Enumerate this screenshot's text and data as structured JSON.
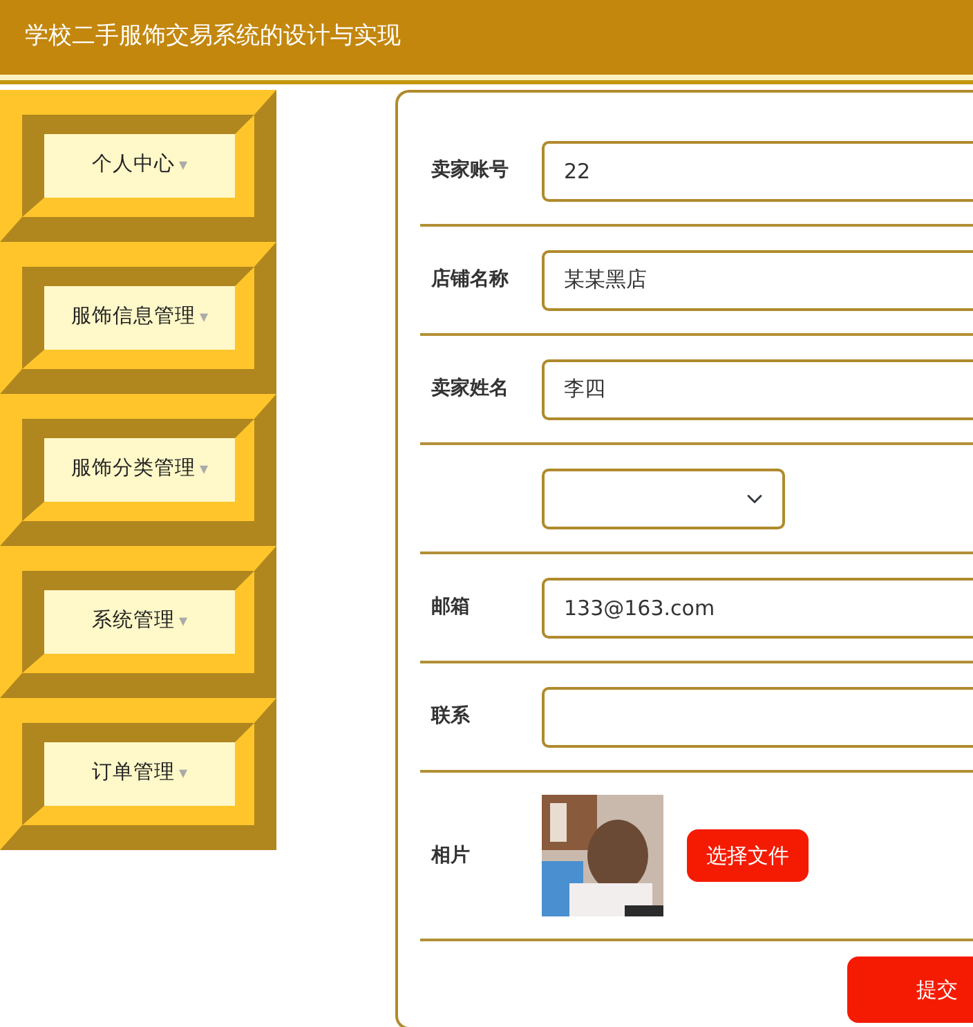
{
  "header": {
    "title": "学校二手服饰交易系统的设计与实现"
  },
  "sidebar": {
    "items": [
      {
        "label": "个人中心",
        "caret": "▾"
      },
      {
        "label": "服饰信息管理",
        "caret": "▾"
      },
      {
        "label": "服饰分类管理",
        "caret": "▾"
      },
      {
        "label": "系统管理",
        "caret": "▾"
      },
      {
        "label": "订单管理",
        "caret": "▾"
      }
    ]
  },
  "form": {
    "fields": [
      {
        "kind": "text",
        "label": "卖家账号",
        "value": "22"
      },
      {
        "kind": "text",
        "label": "店铺名称",
        "value": "某某黑店"
      },
      {
        "kind": "text",
        "label": "卖家姓名",
        "value": "李四"
      },
      {
        "kind": "select"
      },
      {
        "kind": "text",
        "label": "邮箱",
        "value": "133@163.com"
      },
      {
        "kind": "text",
        "label": "联系"
      },
      {
        "label": "相片",
        "button": "选择文件"
      }
    ],
    "submit": "提交"
  }
}
